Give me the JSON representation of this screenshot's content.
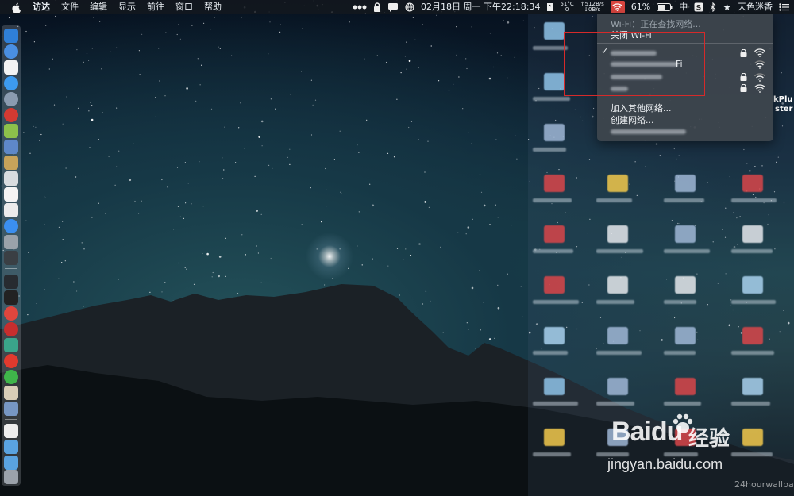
{
  "menubar": {
    "app_name": "访达",
    "menus": [
      "文件",
      "编辑",
      "显示",
      "前往",
      "窗口",
      "帮助"
    ],
    "cpu_temp": "51°C",
    "cpu_value": "0",
    "net_up": "↑512B/s",
    "net_down": "↓0B/s",
    "datetime": "02月18日 周一 下午22:18:34",
    "battery": "61%",
    "input_method": "中",
    "user": "天色迷香"
  },
  "wifi_menu": {
    "status": "Wi-Fi：正在查找网络...",
    "turn_off": "关闭 Wi-Fi",
    "network_suffix": "Fi",
    "join_other": "加入其他网络...",
    "create_network": "创建网络..."
  },
  "side_fragments": [
    "kPlu",
    "ster"
  ],
  "watermark": {
    "brand": "Baidu",
    "brand_cn": "经验",
    "url": "jingyan.baidu.com",
    "credit": "24hourwallpa"
  },
  "colors": {
    "accent_red": "#d9453f",
    "highlight_box": "#d62a2a"
  }
}
